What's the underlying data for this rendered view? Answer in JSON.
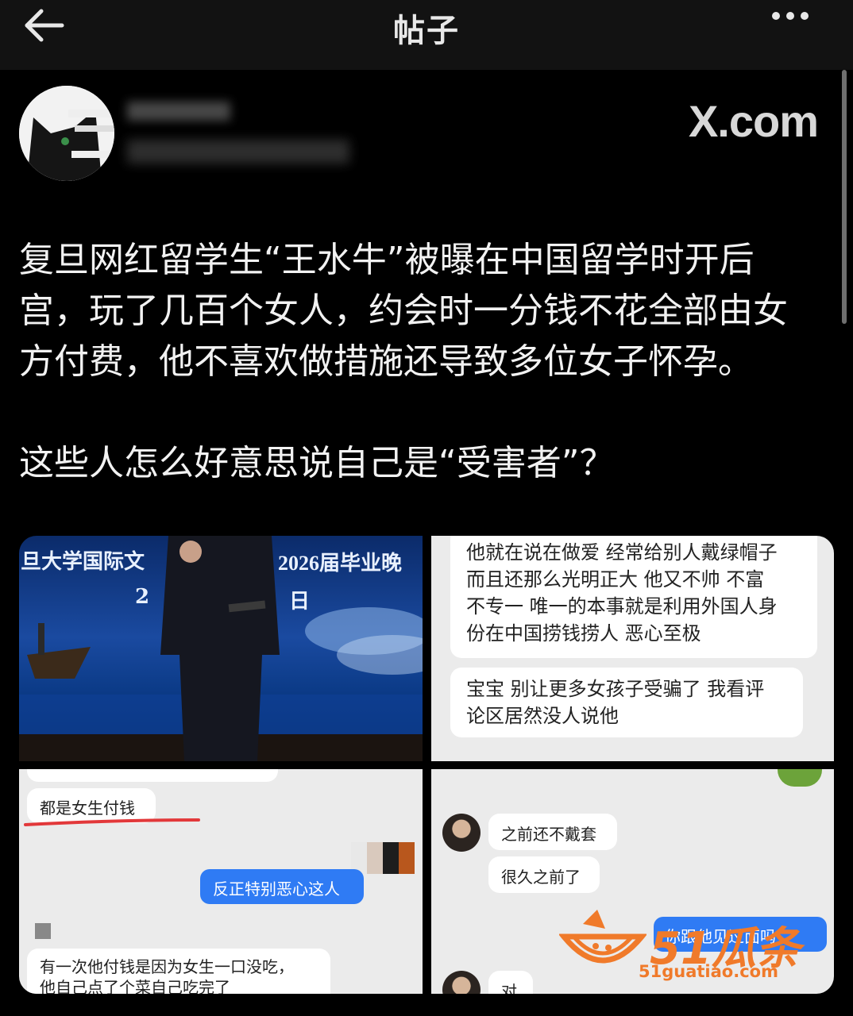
{
  "header": {
    "title": "帖子",
    "back_icon": "arrow-left-icon",
    "more_icon": "more-dots-icon"
  },
  "post": {
    "source": "X.com",
    "paragraphs": [
      "复旦网红留学生“王水牛”被曝在中国留学时开后",
      "宫，玩了几百个女人，约会时一分钱不花全部由女",
      "方付费，他不喜欢做措施还导致多位女子怀孕。",
      "这些人怎么好意思说自己是“受害者”？"
    ]
  },
  "images": {
    "banner": {
      "left_text": "旦大学国际文",
      "right_text": "2026届毕业晚",
      "partial_1": "2",
      "partial_2": "日"
    },
    "chat1": {
      "bubble1_lines": [
        "他就在说在做爱 经常给别人戴绿帽子",
        "而且还那么光明正大 他又不帅 不富",
        "不专一 唯一的本事就是利用外国人身",
        "份在中国捞钱捞人 恶心至极"
      ],
      "bubble2_lines": [
        "宝宝 别让更多女孩子受骗了 我看评",
        "论区居然没人说他"
      ]
    },
    "chat2": {
      "highlight": "都是女生付钱",
      "blue_bubble": "反正特别恶心这人",
      "bubble_lines": [
        "有一次他付钱是因为女生一口没吃，",
        "他自己点了个菜自己吃完了"
      ]
    },
    "chat3": {
      "bubble1": "之前还不戴套",
      "bubble2": "很久之前了",
      "blue_bubble": "你跟他见过面吗",
      "bubble3": "对"
    }
  },
  "watermark": {
    "name": "51瓜条",
    "url": "51guatiao.com"
  },
  "colors": {
    "accent_blue": "#2f7bf4",
    "underline_red": "#e2383a",
    "watermark_orange": "#f07a2a"
  }
}
